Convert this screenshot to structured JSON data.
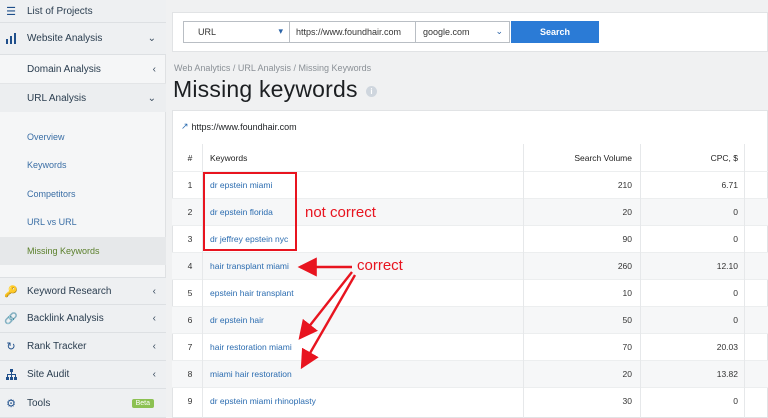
{
  "sidebar": {
    "list_projects": "List of Projects",
    "website_analysis": "Website Analysis",
    "domain_analysis": "Domain Analysis",
    "url_analysis": "URL Analysis",
    "leaves": [
      "Overview",
      "Keywords",
      "Competitors",
      "URL vs URL",
      "Missing Keywords"
    ],
    "active_leaf": "Missing Keywords",
    "keyword_research": "Keyword Research",
    "backlink_analysis": "Backlink Analysis",
    "rank_tracker": "Rank Tracker",
    "site_audit": "Site Audit",
    "tools": "Tools",
    "beta": "Beta"
  },
  "search": {
    "type_value": "URL",
    "url_value": "https://www.foundhair.com",
    "engine_value": "google.com",
    "button_label": "Search"
  },
  "breadcrumb": "Web Analytics / URL Analysis / Missing Keywords",
  "page_title": "Missing keywords",
  "domain": "https://www.foundhair.com",
  "table": {
    "headers": {
      "num": "#",
      "keywords": "Keywords",
      "volume": "Search Volume",
      "cpc": "CPC, $"
    },
    "rows": [
      {
        "num": "1",
        "keyword": "dr epstein miami",
        "volume": "210",
        "cpc": "6.71"
      },
      {
        "num": "2",
        "keyword": "dr epstein florida",
        "volume": "20",
        "cpc": "0"
      },
      {
        "num": "3",
        "keyword": "dr jeffrey epstein nyc",
        "volume": "90",
        "cpc": "0"
      },
      {
        "num": "4",
        "keyword": "hair transplant miami",
        "volume": "260",
        "cpc": "12.10"
      },
      {
        "num": "5",
        "keyword": "epstein hair transplant",
        "volume": "10",
        "cpc": "0"
      },
      {
        "num": "6",
        "keyword": "dr epstein hair",
        "volume": "50",
        "cpc": "0"
      },
      {
        "num": "7",
        "keyword": "hair restoration miami",
        "volume": "70",
        "cpc": "20.03"
      },
      {
        "num": "8",
        "keyword": "miami hair restoration",
        "volume": "20",
        "cpc": "13.82"
      },
      {
        "num": "9",
        "keyword": "dr epstein miami rhinoplasty",
        "volume": "30",
        "cpc": "0"
      }
    ]
  },
  "annotations": {
    "not_correct": "not correct",
    "correct": "correct",
    "color": "#e8141f"
  },
  "colors": {
    "accent": "#2b7bd6",
    "link": "#2b6cb0",
    "active_leaf": "#5a7f2a"
  }
}
